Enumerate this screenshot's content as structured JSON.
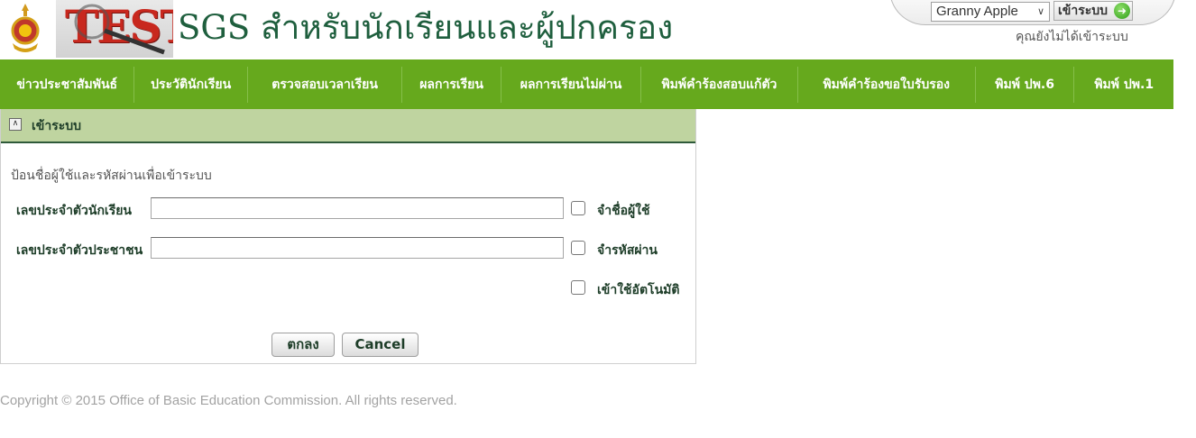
{
  "header": {
    "logo_text": "TEST",
    "site_title": "SGS สำหรับนักเรียนและผู้ปกครอง",
    "user_select_value": "Granny Apple",
    "login_link": "เข้าระบบ",
    "login_status": "คุณยังไม่ได้เข้าระบบ"
  },
  "nav": {
    "items": [
      "ข่าวประชาสัมพันธ์",
      "ประวัตินักเรียน",
      "ตรวจสอบเวลาเรียน",
      "ผลการเรียน",
      "ผลการเรียนไม่ผ่าน",
      "พิมพ์คำร้องสอบแก้ตัว",
      "พิมพ์คำร้องขอใบรับรอง",
      "พิมพ์ ปพ.6",
      "พิมพ์ ปพ.1"
    ]
  },
  "panel": {
    "title": "เข้าระบบ",
    "instruction": "ป้อนชื่อผู้ใช้และรหัสผ่านเพื่อเข้าระบบ",
    "student_id_label": "เลขประจำตัวนักเรียน",
    "student_id_value": "",
    "citizen_id_label": "เลขประจำตัวประชาชน",
    "citizen_id_value": "",
    "remember_user_label": "จำชื่อผู้ใช้",
    "remember_password_label": "จำรหัสผ่าน",
    "auto_login_label": "เข้าใช้อัตโนมัติ",
    "ok_button": "ตกลง",
    "cancel_button": "Cancel"
  },
  "footer": {
    "copyright": "Copyright © 2015 Office of Basic Education Commission. All rights reserved."
  },
  "colors": {
    "nav_bg": "#66a91d",
    "panel_head_bg": "#bfd4a0",
    "title_green": "#1f5f3e",
    "logo_red": "#c8281e"
  }
}
